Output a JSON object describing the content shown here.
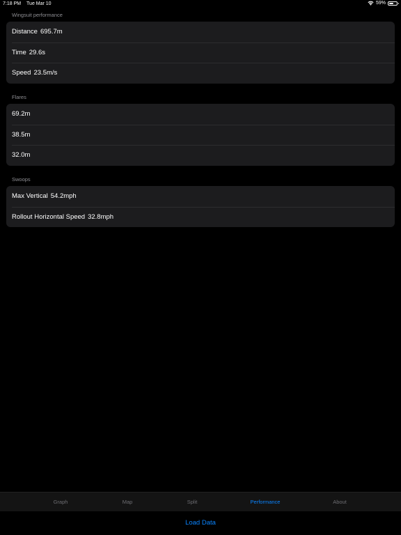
{
  "status_bar": {
    "time": "7:18 PM",
    "date": "Tue Mar 10",
    "battery_percent_label": "59%",
    "battery_level": 0.59,
    "wifi_icon": "wifi-icon",
    "battery_icon": "battery-icon"
  },
  "sections": {
    "wingsuit": {
      "header": "Wingsuit performance",
      "rows": [
        {
          "label": "Distance",
          "value": "695.7m"
        },
        {
          "label": "Time",
          "value": "29.6s"
        },
        {
          "label": "Speed",
          "value": "23.5m/s"
        }
      ]
    },
    "flares": {
      "header": "Flares",
      "rows": [
        {
          "value": "69.2m"
        },
        {
          "value": "38.5m"
        },
        {
          "value": "32.0m"
        }
      ]
    },
    "swoops": {
      "header": "Swoops",
      "rows": [
        {
          "label": "Max Vertical",
          "value": "54.2mph"
        },
        {
          "label": "Rollout Horizontal Speed",
          "value": "32.8mph"
        }
      ]
    }
  },
  "tab_bar": {
    "tabs": [
      {
        "label": "Graph",
        "active": false
      },
      {
        "label": "Map",
        "active": false
      },
      {
        "label": "Split",
        "active": false
      },
      {
        "label": "Performance",
        "active": true
      },
      {
        "label": "About",
        "active": false
      }
    ]
  },
  "load_data_label": "Load Data",
  "colors": {
    "accent": "#0a84ff",
    "background": "#000000",
    "cell": "#1c1c1e",
    "secondary_text": "#8e8e93"
  }
}
